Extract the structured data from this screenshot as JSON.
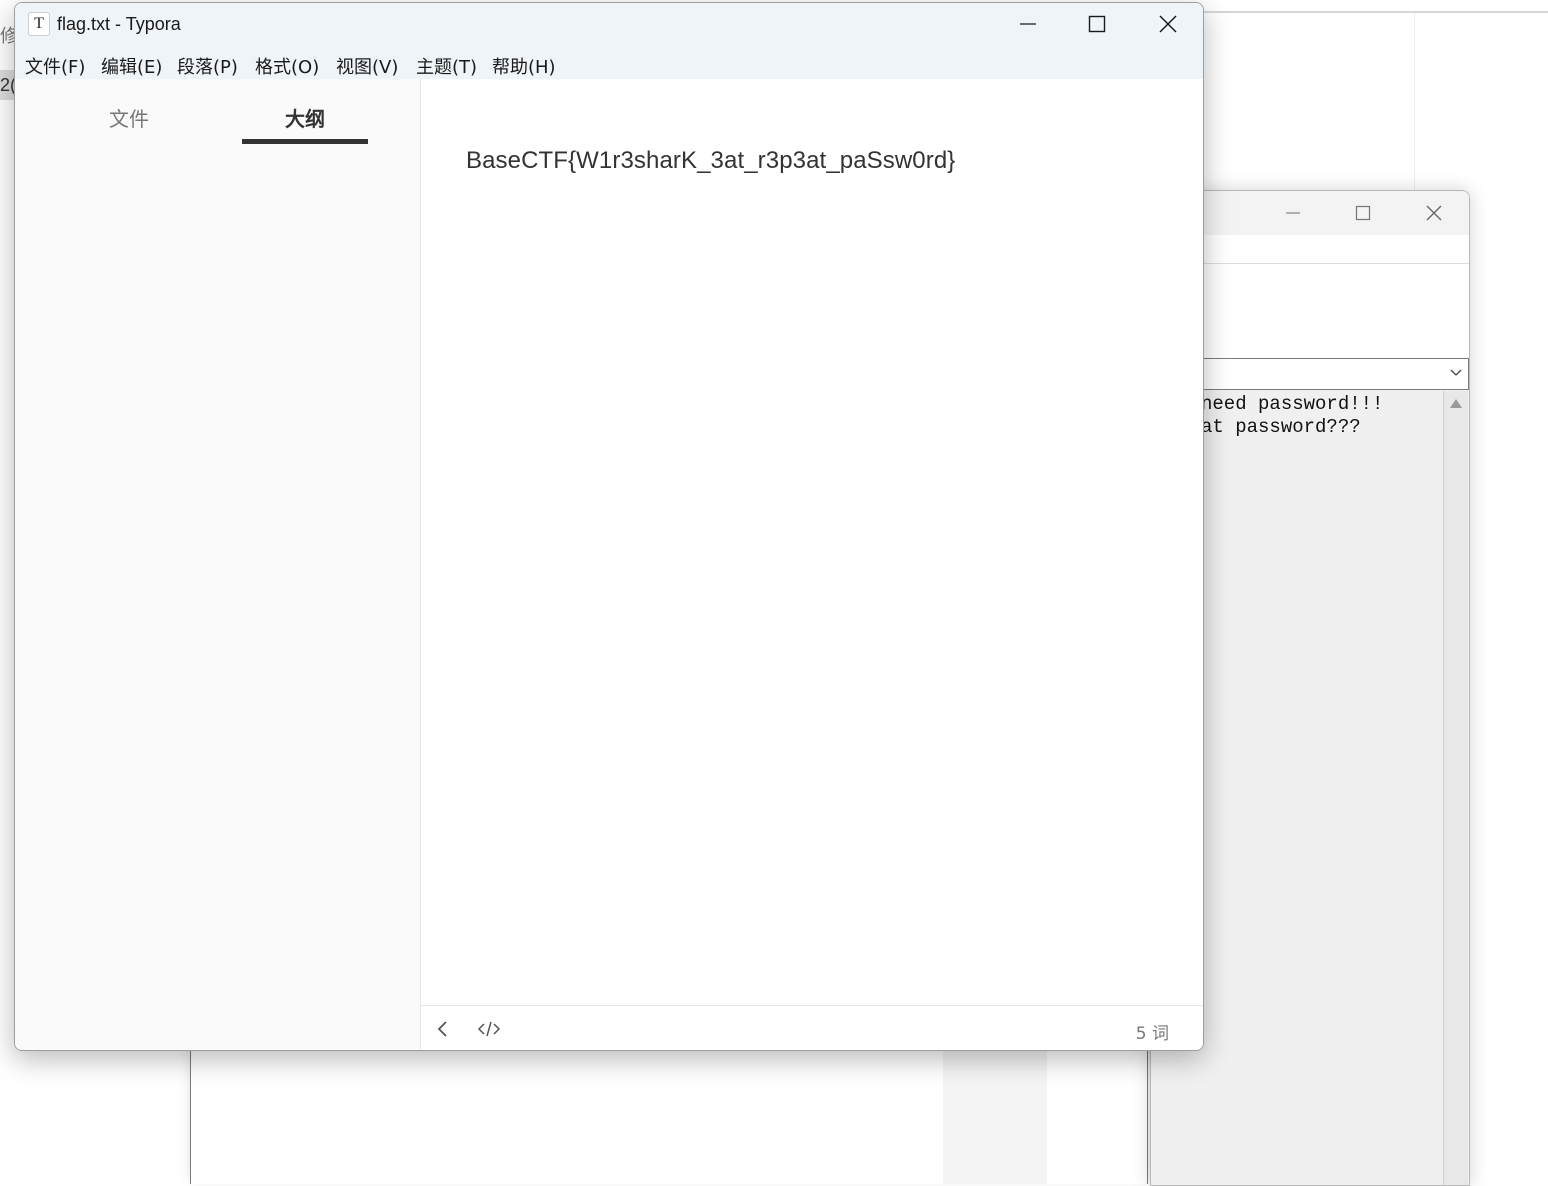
{
  "typora": {
    "title": "flag.txt - Typora",
    "app_icon_letter": "T",
    "menu": [
      "文件(F)",
      "编辑(E)",
      "段落(P)",
      "格式(O)",
      "视图(V)",
      "主题(T)",
      "帮助(H)"
    ],
    "sidebar": {
      "tabs": [
        "文件",
        "大纲"
      ],
      "active_tab": "大纲"
    },
    "content": "BaseCTF{W1r3sharK_3at_r3p3at_paSsw0rd}",
    "footer": {
      "word_count": "5 词"
    }
  },
  "dialog": {
    "text_lines": [
      "need password!!!",
      "at password???"
    ]
  },
  "background": {
    "left_char_1": "修",
    "left_char_2": "2("
  }
}
